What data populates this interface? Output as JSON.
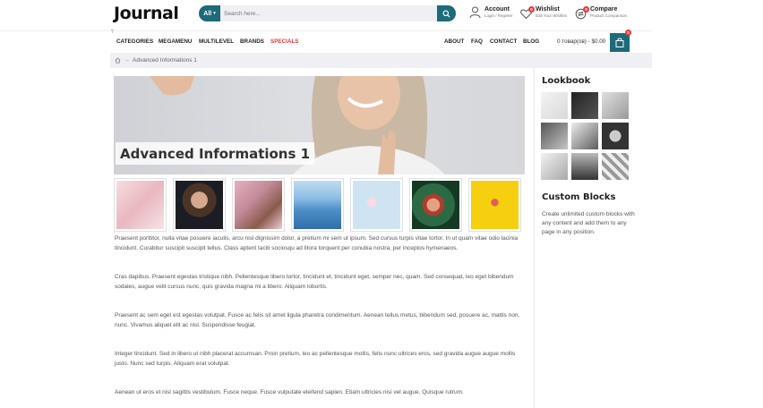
{
  "header": {
    "logo": "Journal",
    "search": {
      "category": "All",
      "placeholder": "Search here..."
    },
    "account": {
      "title": "Account",
      "subtitle": "Login / Register"
    },
    "wishlist": {
      "title": "Wishlist",
      "subtitle": "Edit Your Wishlist",
      "count": "0"
    },
    "compare": {
      "title": "Compare",
      "subtitle": "Product Comparison",
      "count": "0"
    }
  },
  "nav": {
    "help": "?",
    "items": [
      "CATEGORIES",
      "MEGAMENU",
      "MULTILEVEL",
      "BRANDS",
      "SPECIALS"
    ],
    "right_items": [
      "ABOUT",
      "FAQ",
      "CONTACT",
      "BLOG"
    ],
    "cart_text": "0 товар(ов) - $0.00",
    "cart_count": "0"
  },
  "breadcrumb": {
    "current": "Advanced Informations 1"
  },
  "hero": {
    "title": "Advanced Informations 1"
  },
  "gallery": [
    "woman-glasses",
    "woman-dark-hair",
    "woman-pink-cup",
    "blue-mountains",
    "cherry-blossom",
    "woman-leaves",
    "yellow-popsicle"
  ],
  "paragraphs": [
    "Praesent porttitor, nulla vitae posuere iaculis, arcu nisl dignissim dolor, a pretium mi sem ut ipsum. Sed cursus turpis vitae tortor. In ut quam vitae odio lacinia tincidunt. Curabitur suscipit suscipit tellus. Class aptent taciti sociosqu ad litora torquent per conubia nostra, per inceptos hymenaeos.",
    "Cras dapibus. Praesent egestas tristique nibh. Pellentesque libero tortor, tincidunt et, tincidunt eget, semper nec, quam. Sed consequat, leo eget bibendum sodales, augue velit cursus nunc, quis gravida magna mi a libero. Aliquam lobortis.",
    "Praesent ac sem eget est egestas volutpat. Fusce ac felis sit amet ligula pharetra condimentum. Aenean tellus metus, bibendum sed, posuere ac, mattis non, nunc. Vivamus aliquet elit ac nisl. Suspendisse feugiat.",
    "Integer tincidunt. Sed in libero ut nibh placerat accumsan. Proin pretium, leo ac pellentesque mollis, felis nunc ultrices eros, sed gravida augue augue mollis justo. Nunc sed turpis. Aliquam erat volutpat.",
    "Aenean ut eros et nisl sagittis vestibulum. Fusce neque. Fusce vulputate eleifend sapien. Etiam ultricies nisi vel augue. Quisque rutrum."
  ],
  "sidebar": {
    "lookbook_title": "Lookbook",
    "custom_title": "Custom Blocks",
    "custom_text": "Create unlimited custom blocks with any content and add them to any page in any position."
  },
  "colors": {
    "accent": "#1d6a7a",
    "special": "#e53935",
    "badge": "#e53935"
  }
}
